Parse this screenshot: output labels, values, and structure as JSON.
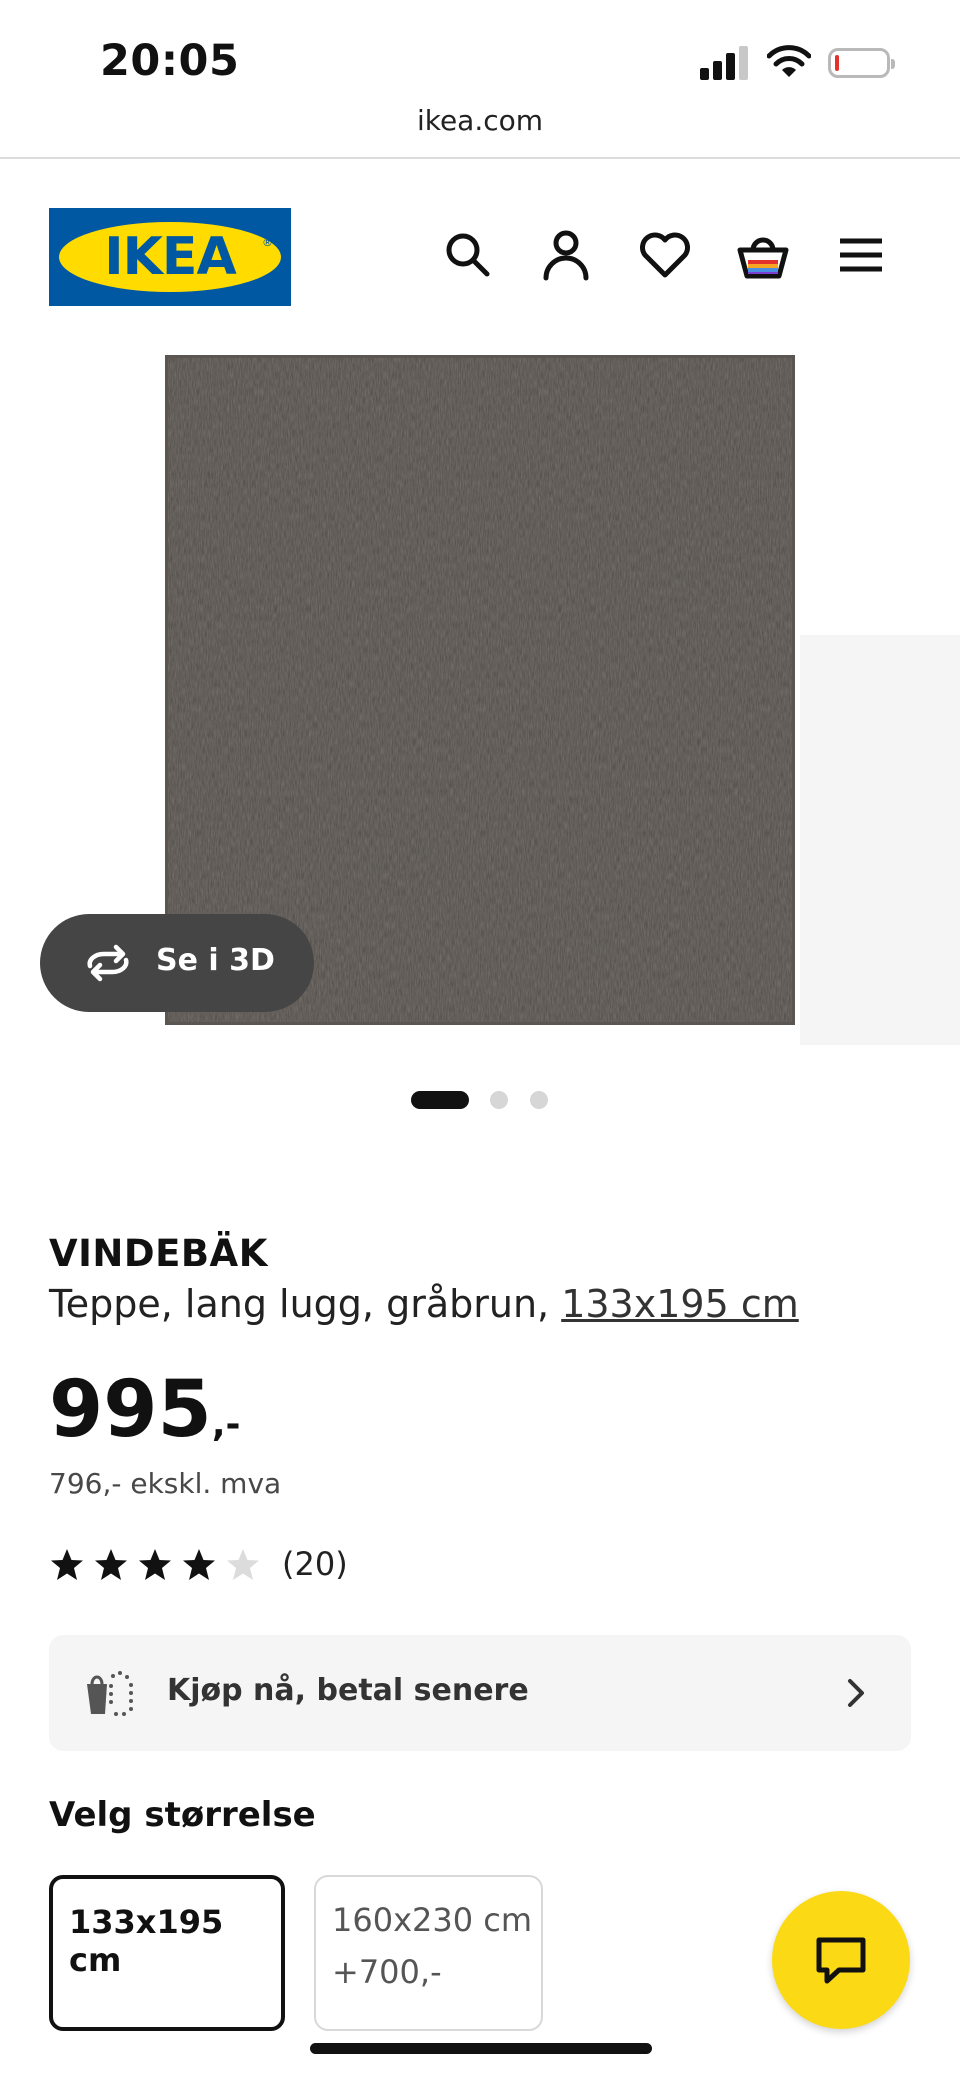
{
  "status_bar": {
    "time": "20:05"
  },
  "browser": {
    "url": "ikea.com"
  },
  "header": {
    "logo_text": "IKEA",
    "logo_reg": "®",
    "icons": [
      "search-icon",
      "account-icon",
      "heart-icon",
      "cart-icon",
      "menu-icon"
    ]
  },
  "gallery": {
    "view_3d_label": "Se i 3D",
    "current_slide": 1,
    "slide_count": 3
  },
  "product": {
    "name": "VINDEBÄK",
    "description": "Teppe, lang lugg, gråbrun,",
    "size_link": "133x195 cm",
    "price_main": "995",
    "price_suffix": ",-",
    "price_ex_vat": "796,- ekskl. mva",
    "rating_value": 4,
    "rating_max": 5,
    "review_count": "(20)"
  },
  "pay_later": {
    "label": "Kjøp nå, betal senere"
  },
  "size_selector": {
    "title": "Velg størrelse",
    "options": [
      {
        "label": "133x195 cm",
        "extra": "",
        "selected": true
      },
      {
        "label": "160x230 cm",
        "extra": "+700,-",
        "selected": false
      }
    ]
  },
  "colors": {
    "ikea_blue": "#0058a3",
    "ikea_yellow": "#ffdb00",
    "chat_button": "#fbd914",
    "rug": "#4e4945"
  }
}
